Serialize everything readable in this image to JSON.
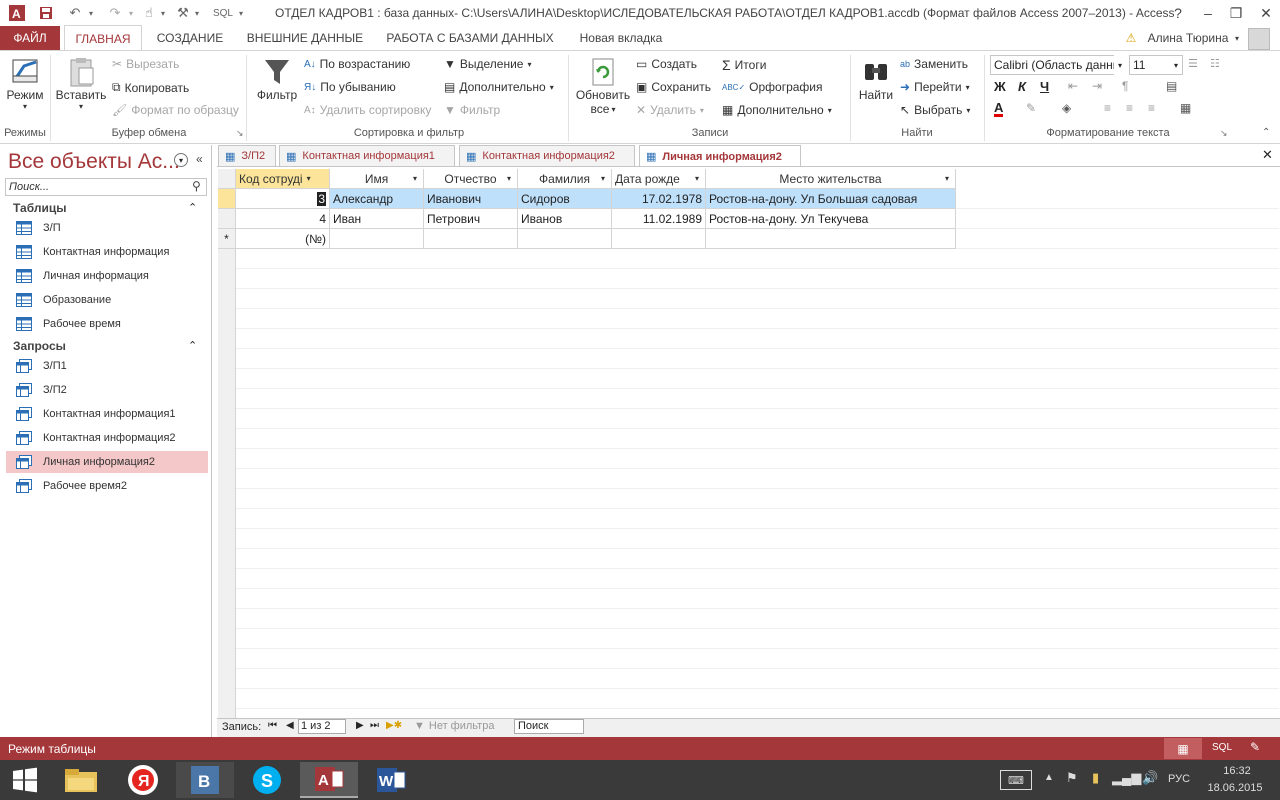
{
  "window": {
    "title": "ОТДЕЛ КАДРОВ1 : база данных- C:\\Users\\АЛИНА\\Desktop\\ИСЛЕДОВАТЕЛЬСКАЯ РАБОТА\\ОТДЕЛ КАДРОВ1.accdb (Формат файлов Access 2007–2013) - Access",
    "qat_sql": "SQL",
    "help": "?"
  },
  "colors": {
    "accent": "#a4373a",
    "selected_row": "#bfe0fb",
    "nav_selected": "#f4c7c8"
  },
  "ribbon_tabs": [
    "ФАЙЛ",
    "ГЛАВНАЯ",
    "СОЗДАНИЕ",
    "ВНЕШНИЕ ДАННЫЕ",
    "РАБОТА С БАЗАМИ ДАННЫХ",
    "Новая вкладка"
  ],
  "user": "Алина Тюрина",
  "ribbon": {
    "views": {
      "mode": "Режим",
      "group": "Режимы"
    },
    "clipboard": {
      "paste": "Вставить",
      "cut": "Вырезать",
      "copy": "Копировать",
      "format_painter": "Формат по образцу",
      "group": "Буфер обмена"
    },
    "sort": {
      "filter": "Фильтр",
      "asc": "По возрастанию",
      "desc": "По убыванию",
      "remove_sort": "Удалить сортировку",
      "selection": "Выделение",
      "advanced": "Дополнительно",
      "toggle_filter": "Фильтр",
      "group": "Сортировка и фильтр"
    },
    "records": {
      "refresh": "Обновить",
      "refresh_sub": "все",
      "new": "Создать",
      "save": "Сохранить",
      "delete": "Удалить",
      "totals": "Итоги",
      "spelling": "Орфография",
      "more": "Дополнительно",
      "group": "Записи"
    },
    "find": {
      "find": "Найти",
      "replace": "Заменить",
      "goto": "Перейти",
      "select": "Выбрать",
      "group": "Найти"
    },
    "text": {
      "font": "Calibri (Область данны",
      "size": "11",
      "bold": "Ж",
      "italic": "К",
      "underline": "Ч",
      "group": "Форматирование текста"
    }
  },
  "nav": {
    "title": "Все объекты Ac...",
    "search_placeholder": "Поиск...",
    "tables_header": "Таблицы",
    "tables": [
      "З/П",
      "Контактная информация",
      "Личная информация",
      "Образование",
      "Рабочее время"
    ],
    "queries_header": "Запросы",
    "queries": [
      "З/П1",
      "З/П2",
      "Контактная информация1",
      "Контактная информация2",
      "Личная информация2",
      "Рабочее время2"
    ]
  },
  "doc_tabs": [
    "З/П2",
    "Контактная информация1",
    "Контактная информация2",
    "Личная информация2"
  ],
  "grid": {
    "columns": [
      "Код сотруді",
      "Имя",
      "Отчество",
      "Фамилия",
      "Дата рожде",
      "Место жительства"
    ],
    "rows": [
      [
        "3",
        "Александр",
        "Иванович",
        "Сидоров",
        "17.02.1978",
        "Ростов-на-дону. Ул Большая садовая"
      ],
      [
        "4",
        "Иван",
        "Петрович",
        "Иванов",
        "11.02.1989",
        "Ростов-на-дону. Ул Текучева"
      ]
    ],
    "new_row_marker": "*",
    "new_row_id": "(№)"
  },
  "record_nav": {
    "label": "Запись:",
    "position": "1 из 2",
    "filter": "Нет фильтра",
    "search": "Поиск"
  },
  "status": {
    "mode": "Режим таблицы",
    "sql": "SQL"
  },
  "taskbar": {
    "lang": "РУС",
    "time": "16:32",
    "date": "18.06.2015"
  }
}
